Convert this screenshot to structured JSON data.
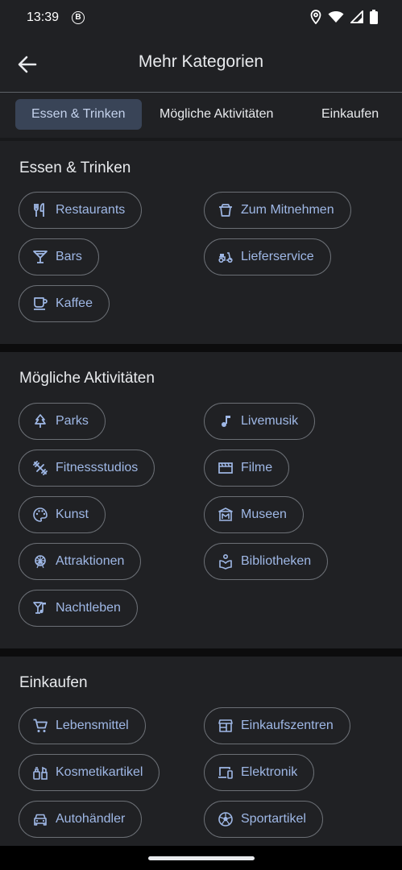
{
  "status": {
    "time": "13:39",
    "b_badge": "B"
  },
  "appbar": {
    "title": "Mehr Kategorien"
  },
  "tabs": [
    {
      "label": "Essen & Trinken"
    },
    {
      "label": "Mögliche Aktivitäten"
    },
    {
      "label": "Einkaufen"
    }
  ],
  "sections": [
    {
      "title": "Essen & Trinken",
      "chips": [
        {
          "label": "Restaurants",
          "icon": "fork-knife-icon"
        },
        {
          "label": "Zum Mitnehmen",
          "icon": "takeout-icon"
        },
        {
          "label": "Bars",
          "icon": "cocktail-icon"
        },
        {
          "label": "Lieferservice",
          "icon": "scooter-icon"
        },
        {
          "label": "Kaffee",
          "icon": "coffee-icon"
        }
      ]
    },
    {
      "title": "Mögliche Aktivitäten",
      "chips": [
        {
          "label": "Parks",
          "icon": "tree-icon"
        },
        {
          "label": "Livemusik",
          "icon": "music-note-icon"
        },
        {
          "label": "Fitnessstudios",
          "icon": "dumbbell-icon"
        },
        {
          "label": "Filme",
          "icon": "movie-icon"
        },
        {
          "label": "Kunst",
          "icon": "palette-icon"
        },
        {
          "label": "Museen",
          "icon": "museum-icon"
        },
        {
          "label": "Attraktionen",
          "icon": "ferris-wheel-icon"
        },
        {
          "label": "Bibliotheken",
          "icon": "library-icon"
        },
        {
          "label": "Nachtleben",
          "icon": "nightlife-icon"
        }
      ]
    },
    {
      "title": "Einkaufen",
      "chips": [
        {
          "label": "Lebensmittel",
          "icon": "cart-icon"
        },
        {
          "label": "Einkaufszentren",
          "icon": "store-icon"
        },
        {
          "label": "Kosmetikartikel",
          "icon": "cosmetics-icon"
        },
        {
          "label": "Elektronik",
          "icon": "devices-icon"
        },
        {
          "label": "Autohändler",
          "icon": "car-icon"
        },
        {
          "label": "Sportartikel",
          "icon": "soccer-ball-icon"
        }
      ]
    }
  ],
  "colors": {
    "accent": "#9fb8e6",
    "background": "#202124",
    "tab_active": "#394457"
  }
}
